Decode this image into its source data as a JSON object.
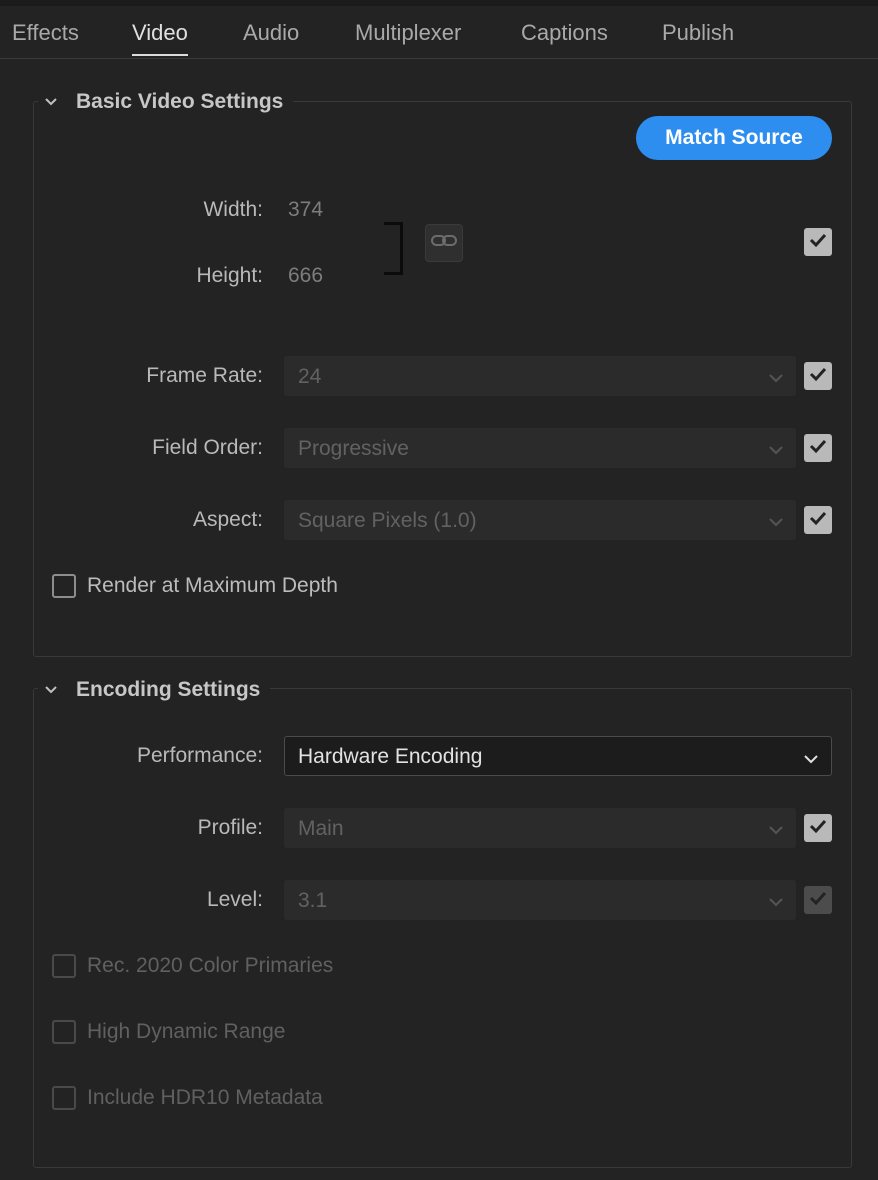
{
  "tabs": [
    {
      "label": "Effects",
      "active": false
    },
    {
      "label": "Video",
      "active": true
    },
    {
      "label": "Audio",
      "active": false
    },
    {
      "label": "Multiplexer",
      "active": false
    },
    {
      "label": "Captions",
      "active": false
    },
    {
      "label": "Publish",
      "active": false
    }
  ],
  "basic": {
    "title": "Basic Video Settings",
    "match_source": "Match Source",
    "width_label": "Width:",
    "width_value": "374",
    "height_label": "Height:",
    "height_value": "666",
    "frame_rate_label": "Frame Rate:",
    "frame_rate_value": "24",
    "field_order_label": "Field Order:",
    "field_order_value": "Progressive",
    "aspect_label": "Aspect:",
    "aspect_value": "Square Pixels (1.0)",
    "render_max_depth": "Render at Maximum Depth"
  },
  "encoding": {
    "title": "Encoding Settings",
    "performance_label": "Performance:",
    "performance_value": "Hardware Encoding",
    "profile_label": "Profile:",
    "profile_value": "Main",
    "level_label": "Level:",
    "level_value": "3.1",
    "rec2020": "Rec. 2020 Color Primaries",
    "hdr": "High Dynamic Range",
    "hdr10": "Include HDR10 Metadata"
  },
  "colors": {
    "accent": "#2e8ef0",
    "background": "#232323",
    "checkbox_checked": "#b9b9b9"
  }
}
